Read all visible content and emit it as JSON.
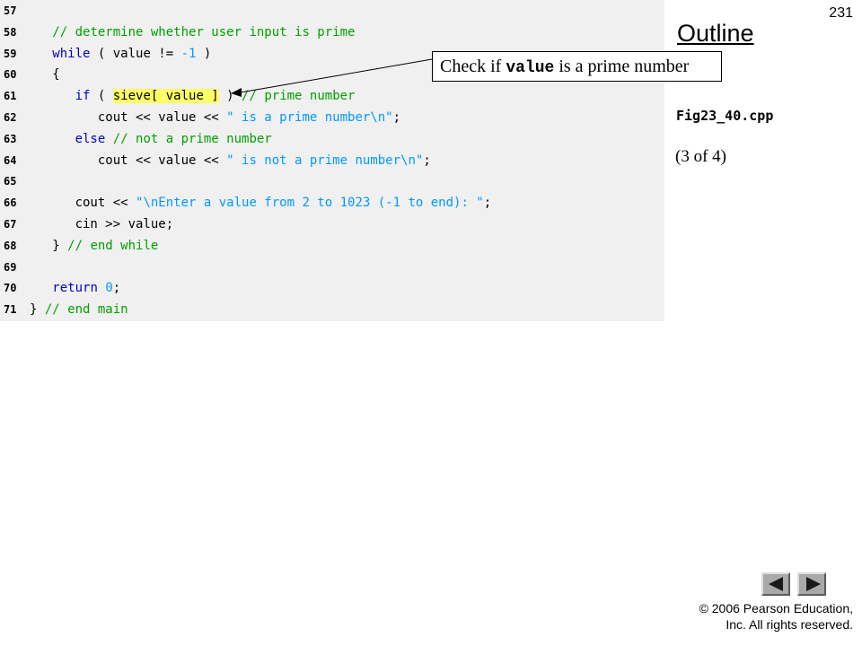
{
  "slide_number": "231",
  "outline": {
    "title": "Outline",
    "file_name": "Fig23_40.cpp",
    "page_of": "(3 of 4)"
  },
  "callout": {
    "prefix": "Check if ",
    "code": "value",
    "suffix": " is a prime number"
  },
  "code": {
    "lines": [
      {
        "num": "57",
        "segments": []
      },
      {
        "num": "58",
        "segments": [
          {
            "text": "   ",
            "cls": ""
          },
          {
            "text": "// determine whether user input is prime",
            "cls": "cm"
          }
        ]
      },
      {
        "num": "59",
        "segments": [
          {
            "text": "   ",
            "cls": ""
          },
          {
            "text": "while",
            "cls": "kw"
          },
          {
            "text": " ( value != ",
            "cls": ""
          },
          {
            "text": "-1",
            "cls": "nm"
          },
          {
            "text": " )",
            "cls": ""
          }
        ]
      },
      {
        "num": "60",
        "segments": [
          {
            "text": "   {",
            "cls": ""
          }
        ]
      },
      {
        "num": "61",
        "segments": [
          {
            "text": "      ",
            "cls": ""
          },
          {
            "text": "if",
            "cls": "kw"
          },
          {
            "text": " ( ",
            "cls": ""
          },
          {
            "text": "sieve[ value ]",
            "cls": "hl"
          },
          {
            "text": " ) ",
            "cls": ""
          },
          {
            "text": "// prime number",
            "cls": "cm"
          }
        ]
      },
      {
        "num": "62",
        "segments": [
          {
            "text": "         cout << value << ",
            "cls": ""
          },
          {
            "text": "\" is a prime number\\n\"",
            "cls": "st"
          },
          {
            "text": ";",
            "cls": ""
          }
        ]
      },
      {
        "num": "63",
        "segments": [
          {
            "text": "      ",
            "cls": ""
          },
          {
            "text": "else",
            "cls": "kw"
          },
          {
            "text": " ",
            "cls": ""
          },
          {
            "text": "// not a prime number",
            "cls": "cm"
          }
        ]
      },
      {
        "num": "64",
        "segments": [
          {
            "text": "         cout << value << ",
            "cls": ""
          },
          {
            "text": "\" is not a prime number\\n\"",
            "cls": "st"
          },
          {
            "text": ";",
            "cls": ""
          }
        ]
      },
      {
        "num": "65",
        "segments": []
      },
      {
        "num": "66",
        "segments": [
          {
            "text": "      cout << ",
            "cls": ""
          },
          {
            "text": "\"\\nEnter a value from 2 to 1023 (-1 to end): \"",
            "cls": "st"
          },
          {
            "text": ";",
            "cls": ""
          }
        ]
      },
      {
        "num": "67",
        "segments": [
          {
            "text": "      cin >> value;",
            "cls": ""
          }
        ]
      },
      {
        "num": "68",
        "segments": [
          {
            "text": "   } ",
            "cls": ""
          },
          {
            "text": "// end while",
            "cls": "cm"
          }
        ]
      },
      {
        "num": "69",
        "segments": []
      },
      {
        "num": "70",
        "segments": [
          {
            "text": "   ",
            "cls": ""
          },
          {
            "text": "return",
            "cls": "kw"
          },
          {
            "text": " ",
            "cls": ""
          },
          {
            "text": "0",
            "cls": "nm"
          },
          {
            "text": ";",
            "cls": ""
          }
        ]
      },
      {
        "num": "71",
        "segments": [
          {
            "text": "} ",
            "cls": ""
          },
          {
            "text": "// end main",
            "cls": "cm"
          }
        ]
      }
    ]
  },
  "nav": {
    "prev_icon": "triangle-left-icon",
    "next_icon": "triangle-right-icon"
  },
  "copyright": {
    "line1": "© 2006 Pearson Education,",
    "line2": "Inc.  All rights reserved."
  }
}
